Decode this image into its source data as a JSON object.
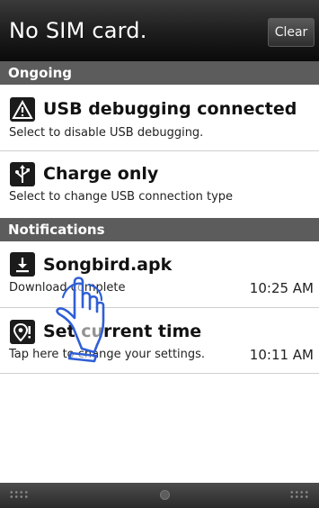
{
  "header": {
    "title": "No SIM card.",
    "clear_label": "Clear"
  },
  "sections": {
    "ongoing": "Ongoing",
    "notifications": "Notifications"
  },
  "ongoing_items": [
    {
      "icon": "warning-icon",
      "title": "USB debugging connected",
      "subtitle": "Select to disable USB debugging."
    },
    {
      "icon": "usb-icon",
      "title": "Charge only",
      "subtitle": "Select to change USB connection type"
    }
  ],
  "notification_items": [
    {
      "icon": "download-icon",
      "title": "Songbird.apk",
      "subtitle": "Download complete",
      "time": "10:25 AM"
    },
    {
      "icon": "location-settings-icon",
      "title": "Set current time",
      "subtitle": "Tap here to change your settings.",
      "time": "10:11 AM"
    }
  ],
  "colors": {
    "header_bg": "#1c1c1c",
    "section_bg": "#5c5c5c",
    "icon_bg": "#1b1b1b"
  }
}
